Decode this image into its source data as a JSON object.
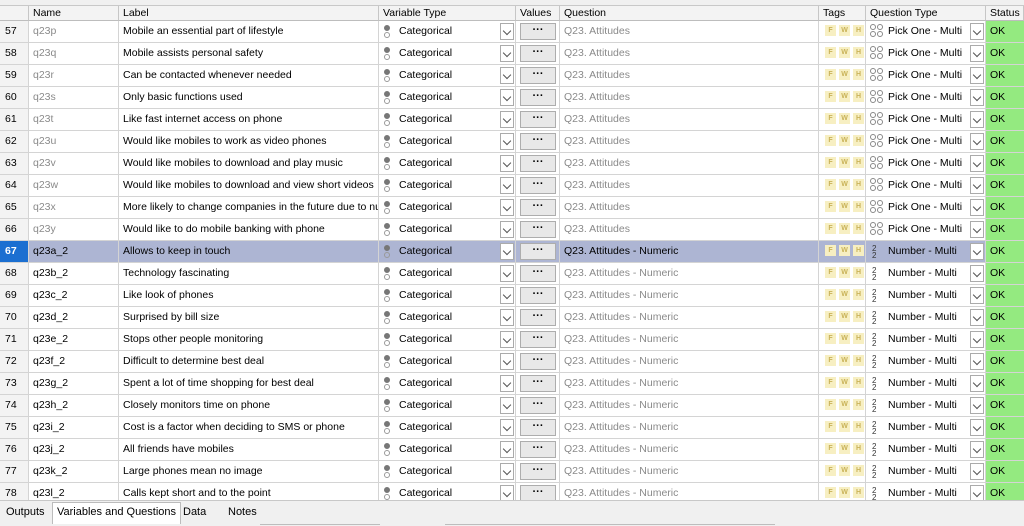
{
  "columns": {
    "name": "Name",
    "label": "Label",
    "variable_type": "Variable Type",
    "values": "Values",
    "question": "Question",
    "tags": "Tags",
    "question_type": "Question Type",
    "status": "Status"
  },
  "values_button": "···",
  "tag_letters": [
    "F",
    "W",
    "H"
  ],
  "number_icon": "2\n2",
  "rows": [
    {
      "num": "57",
      "name": "q23p",
      "label": "Mobile an essential part of lifestyle",
      "vtype": "Categorical",
      "question": "Q23. Attitudes",
      "qtype": "Pick One - Multi",
      "status": "OK",
      "qicon": "pick"
    },
    {
      "num": "58",
      "name": "q23q",
      "label": "Mobile assists personal safety",
      "vtype": "Categorical",
      "question": "Q23. Attitudes",
      "qtype": "Pick One - Multi",
      "status": "OK",
      "qicon": "pick"
    },
    {
      "num": "59",
      "name": "q23r",
      "label": "Can be contacted whenever needed",
      "vtype": "Categorical",
      "question": "Q23. Attitudes",
      "qtype": "Pick One - Multi",
      "status": "OK",
      "qicon": "pick"
    },
    {
      "num": "60",
      "name": "q23s",
      "label": "Only basic functions used",
      "vtype": "Categorical",
      "question": "Q23. Attitudes",
      "qtype": "Pick One - Multi",
      "status": "OK",
      "qicon": "pick"
    },
    {
      "num": "61",
      "name": "q23t",
      "label": "Like fast internet access on phone",
      "vtype": "Categorical",
      "question": "Q23. Attitudes",
      "qtype": "Pick One - Multi",
      "status": "OK",
      "qicon": "pick"
    },
    {
      "num": "62",
      "name": "q23u",
      "label": "Would like mobiles to work as video phones",
      "vtype": "Categorical",
      "question": "Q23. Attitudes",
      "qtype": "Pick One - Multi",
      "status": "OK",
      "qicon": "pick"
    },
    {
      "num": "63",
      "name": "q23v",
      "label": "Would like mobiles to download and play music",
      "vtype": "Categorical",
      "question": "Q23. Attitudes",
      "qtype": "Pick One - Multi",
      "status": "OK",
      "qicon": "pick"
    },
    {
      "num": "64",
      "name": "q23w",
      "label": "Would like mobiles to download and view short videos",
      "vtype": "Categorical",
      "question": "Q23. Attitudes",
      "qtype": "Pick One - Multi",
      "status": "OK",
      "qicon": "pick"
    },
    {
      "num": "65",
      "name": "q23x",
      "label": "More likely to change companies in the future due to nu...",
      "vtype": "Categorical",
      "question": "Q23. Attitudes",
      "qtype": "Pick One - Multi",
      "status": "OK",
      "qicon": "pick"
    },
    {
      "num": "66",
      "name": "q23y",
      "label": "Would like to do mobile banking with phone",
      "vtype": "Categorical",
      "question": "Q23. Attitudes",
      "qtype": "Pick One - Multi",
      "status": "OK",
      "qicon": "pick"
    },
    {
      "num": "67",
      "name": "q23a_2",
      "label": "Allows to keep in touch",
      "vtype": "Categorical",
      "question": "Q23. Attitudes - Numeric",
      "qtype": "Number - Multi",
      "status": "OK",
      "qicon": "num",
      "selected": true
    },
    {
      "num": "68",
      "name": "q23b_2",
      "label": "Technology fascinating",
      "vtype": "Categorical",
      "question": "Q23. Attitudes - Numeric",
      "qtype": "Number - Multi",
      "status": "OK",
      "qicon": "num"
    },
    {
      "num": "69",
      "name": "q23c_2",
      "label": "Like look of phones",
      "vtype": "Categorical",
      "question": "Q23. Attitudes - Numeric",
      "qtype": "Number - Multi",
      "status": "OK",
      "qicon": "num"
    },
    {
      "num": "70",
      "name": "q23d_2",
      "label": "Surprised by bill size",
      "vtype": "Categorical",
      "question": "Q23. Attitudes - Numeric",
      "qtype": "Number - Multi",
      "status": "OK",
      "qicon": "num"
    },
    {
      "num": "71",
      "name": "q23e_2",
      "label": "Stops other people monitoring",
      "vtype": "Categorical",
      "question": "Q23. Attitudes - Numeric",
      "qtype": "Number - Multi",
      "status": "OK",
      "qicon": "num"
    },
    {
      "num": "72",
      "name": "q23f_2",
      "label": "Difficult to determine best deal",
      "vtype": "Categorical",
      "question": "Q23. Attitudes - Numeric",
      "qtype": "Number - Multi",
      "status": "OK",
      "qicon": "num"
    },
    {
      "num": "73",
      "name": "q23g_2",
      "label": "Spent a lot of time shopping for best deal",
      "vtype": "Categorical",
      "question": "Q23. Attitudes - Numeric",
      "qtype": "Number - Multi",
      "status": "OK",
      "qicon": "num"
    },
    {
      "num": "74",
      "name": "q23h_2",
      "label": "Closely monitors time on phone",
      "vtype": "Categorical",
      "question": "Q23. Attitudes - Numeric",
      "qtype": "Number - Multi",
      "status": "OK",
      "qicon": "num"
    },
    {
      "num": "75",
      "name": "q23i_2",
      "label": "Cost is a factor when deciding to SMS or phone",
      "vtype": "Categorical",
      "question": "Q23. Attitudes - Numeric",
      "qtype": "Number - Multi",
      "status": "OK",
      "qicon": "num"
    },
    {
      "num": "76",
      "name": "q23j_2",
      "label": "All friends have mobiles",
      "vtype": "Categorical",
      "question": "Q23. Attitudes - Numeric",
      "qtype": "Number - Multi",
      "status": "OK",
      "qicon": "num"
    },
    {
      "num": "77",
      "name": "q23k_2",
      "label": "Large phones mean no image",
      "vtype": "Categorical",
      "question": "Q23. Attitudes - Numeric",
      "qtype": "Number - Multi",
      "status": "OK",
      "qicon": "num"
    },
    {
      "num": "78",
      "name": "q23l_2",
      "label": "Calls kept short and to the point",
      "vtype": "Categorical",
      "question": "Q23. Attitudes - Numeric",
      "qtype": "Number - Multi",
      "status": "OK",
      "qicon": "num"
    }
  ],
  "tabs": [
    {
      "label": "Outputs",
      "active": false
    },
    {
      "label": "Variables and Questions",
      "active": true
    },
    {
      "label": "Data",
      "active": false
    },
    {
      "label": "Notes",
      "active": false
    }
  ],
  "colors": {
    "status_ok": "#94ea80",
    "selected_row": "#adb5d3",
    "selected_num": "#1b6fd1",
    "tag_bg": "#f7efc2"
  }
}
